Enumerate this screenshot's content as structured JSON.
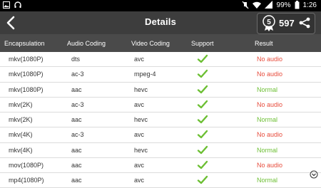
{
  "status_bar": {
    "battery": "99%",
    "time": "1:26"
  },
  "app_bar": {
    "title": "Details",
    "score": "597"
  },
  "table": {
    "headers": [
      "Encapsulation",
      "Audio Coding",
      "Video Coding",
      "Support",
      "Result"
    ],
    "rows": [
      {
        "enc": "mkv(1080P)",
        "audio": "dts",
        "video": "avc",
        "result": "No audio",
        "ok": false
      },
      {
        "enc": "mkv(1080P)",
        "audio": "ac-3",
        "video": "mpeg-4",
        "result": "No audio",
        "ok": false
      },
      {
        "enc": "mkv(1080P)",
        "audio": "aac",
        "video": "hevc",
        "result": "Normal",
        "ok": true
      },
      {
        "enc": "mkv(2K)",
        "audio": "ac-3",
        "video": "avc",
        "result": "No audio",
        "ok": false
      },
      {
        "enc": "mkv(2K)",
        "audio": "aac",
        "video": "hevc",
        "result": "Normal",
        "ok": true
      },
      {
        "enc": "mkv(4K)",
        "audio": "ac-3",
        "video": "avc",
        "result": "No audio",
        "ok": false
      },
      {
        "enc": "mkv(4K)",
        "audio": "aac",
        "video": "hevc",
        "result": "Normal",
        "ok": true
      },
      {
        "enc": "mov(1080P)",
        "audio": "aac",
        "video": "avc",
        "result": "No audio",
        "ok": false
      },
      {
        "enc": "mp4(1080P)",
        "audio": "aac",
        "video": "avc",
        "result": "Normal",
        "ok": true
      }
    ]
  },
  "colors": {
    "normal": "#6cbf33",
    "no_audio": "#e74c3c",
    "check": "#6cbf33"
  }
}
